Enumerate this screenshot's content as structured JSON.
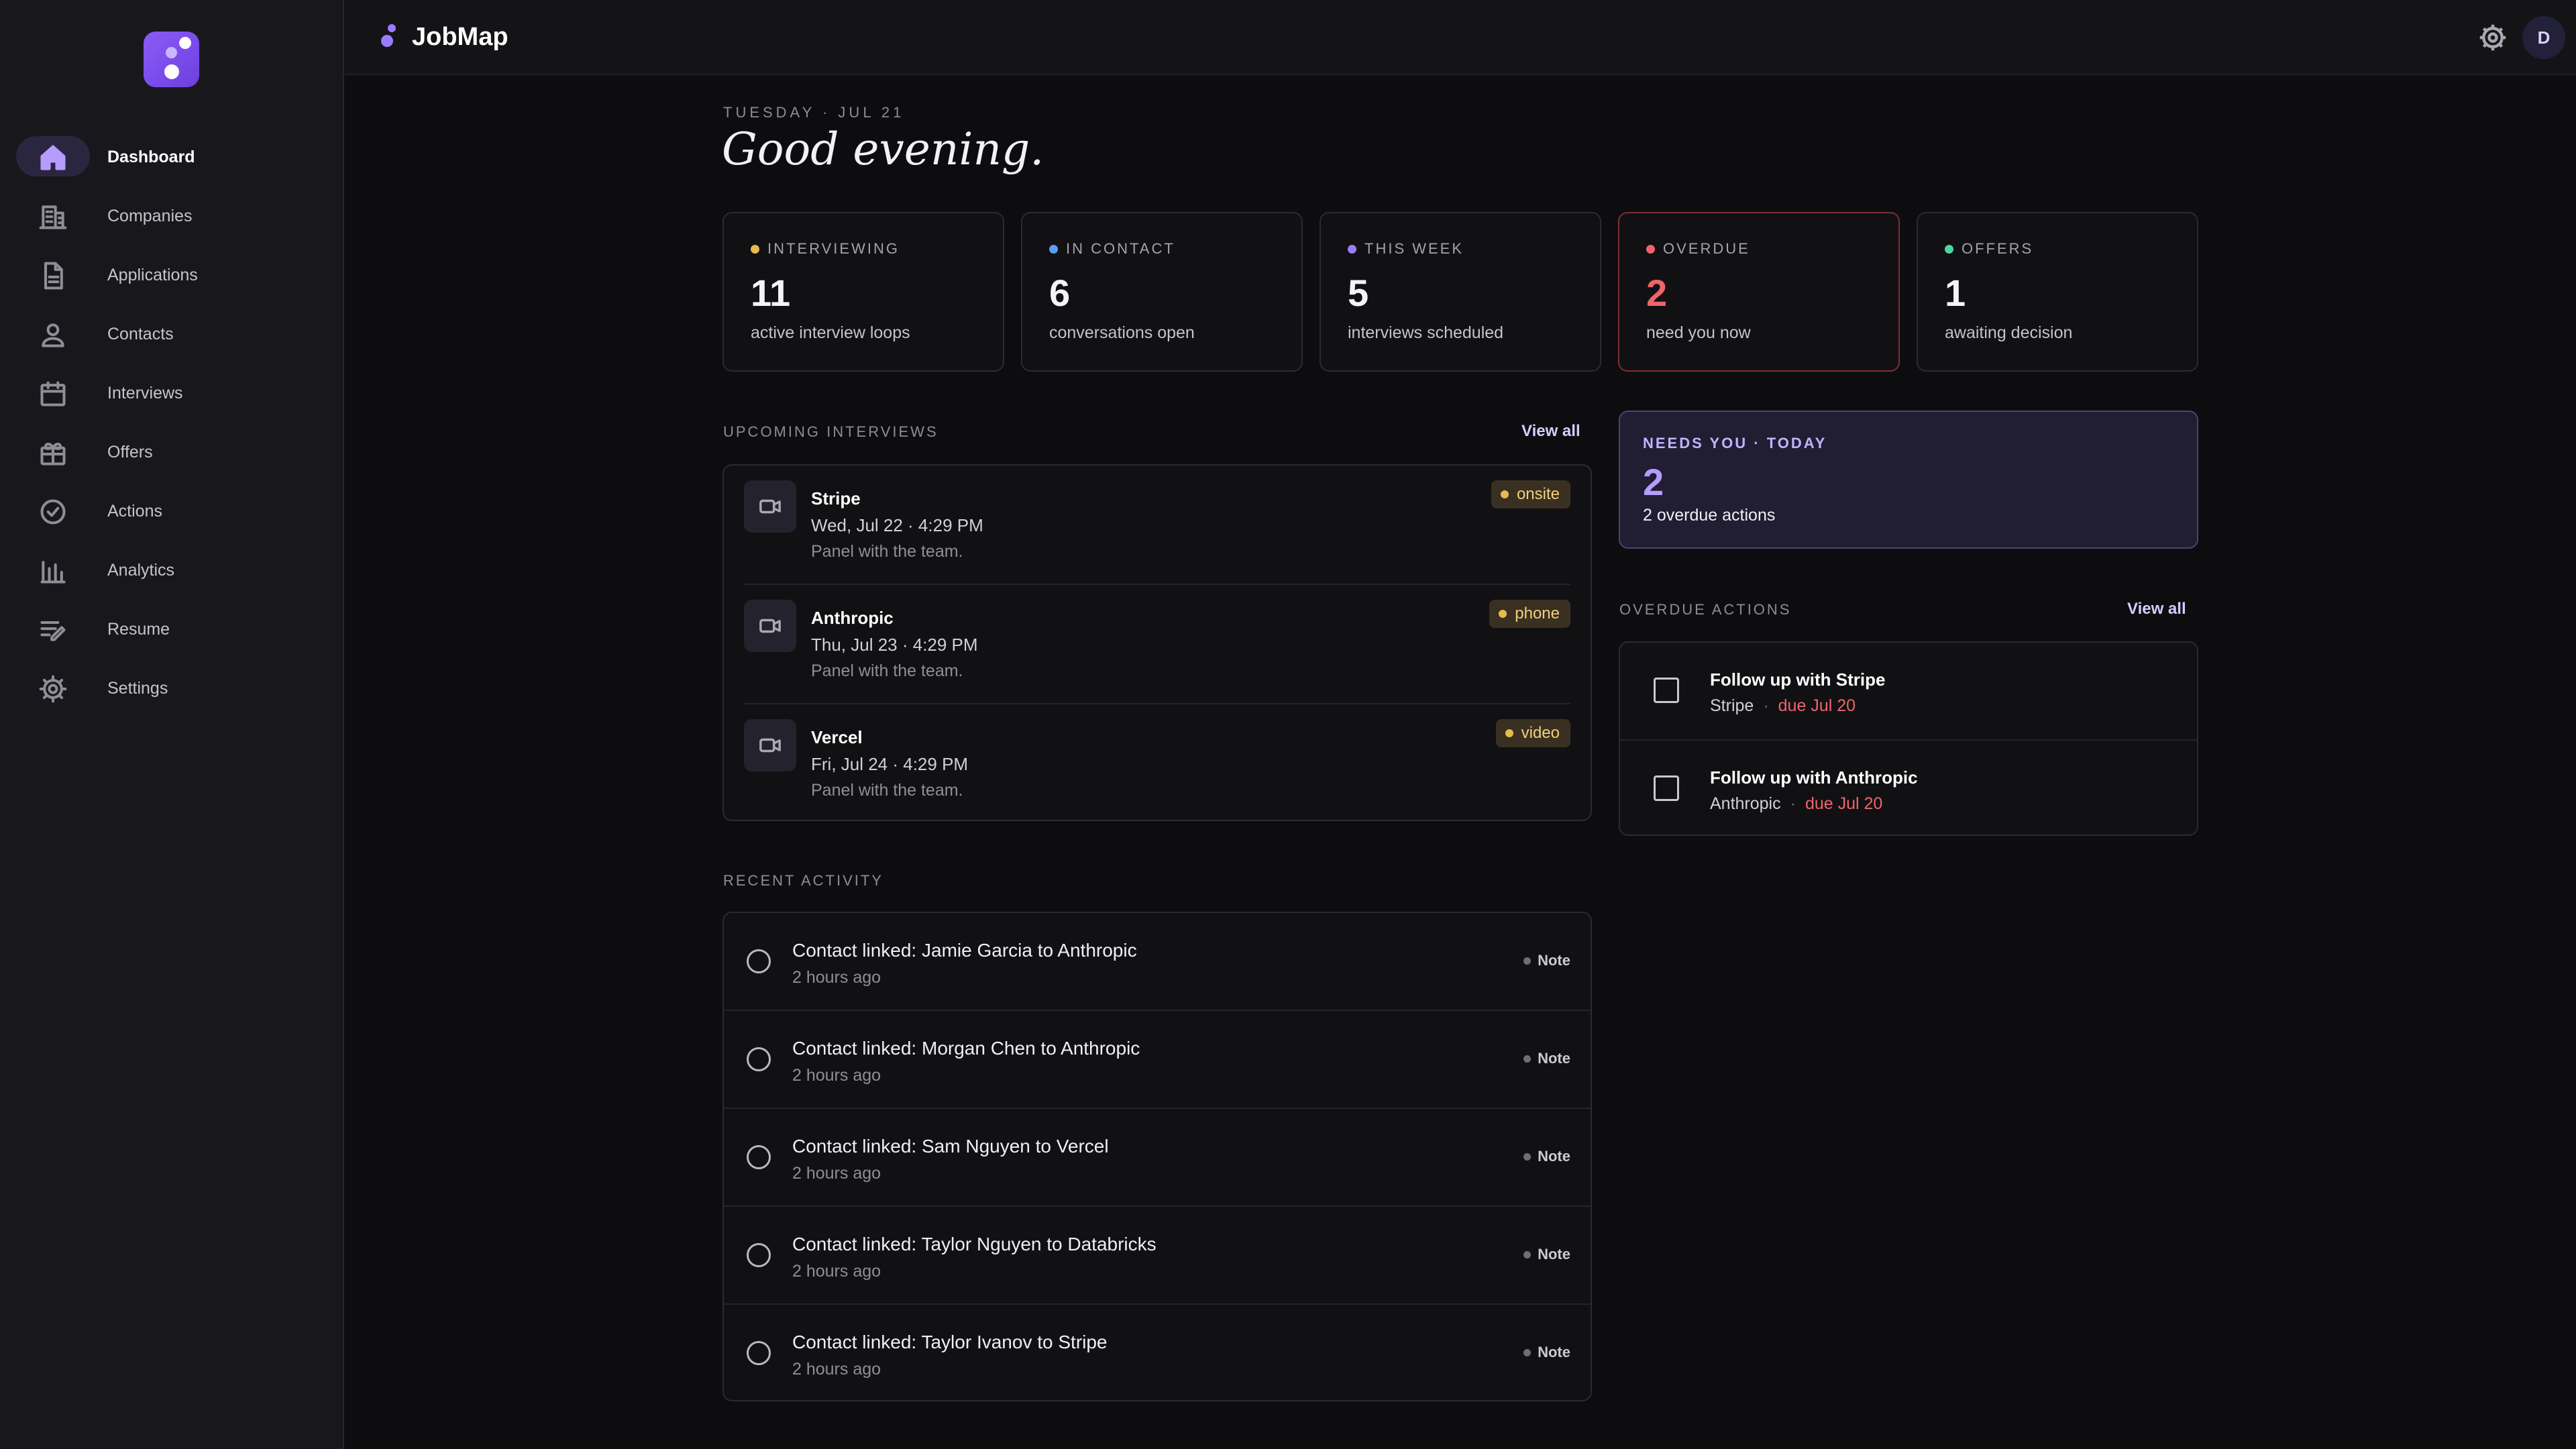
{
  "app": {
    "title": "JobMap",
    "avatar_initial": "D"
  },
  "sidebar": {
    "items": [
      {
        "label": "Dashboard",
        "icon": "home-icon",
        "active": true
      },
      {
        "label": "Companies",
        "icon": "building-icon"
      },
      {
        "label": "Applications",
        "icon": "document-icon"
      },
      {
        "label": "Contacts",
        "icon": "person-icon"
      },
      {
        "label": "Interviews",
        "icon": "calendar-icon"
      },
      {
        "label": "Offers",
        "icon": "gift-icon"
      },
      {
        "label": "Actions",
        "icon": "check-circle-icon"
      },
      {
        "label": "Analytics",
        "icon": "bar-chart-icon"
      },
      {
        "label": "Resume",
        "icon": "edit-list-icon"
      },
      {
        "label": "Settings",
        "icon": "gear-icon"
      }
    ]
  },
  "header": {
    "date": "TUESDAY · JUL 21",
    "greeting": "Good evening."
  },
  "stats": [
    {
      "label": "INTERVIEWING",
      "value": "11",
      "sub": "active interview loops",
      "dot_color": "#e8b94e"
    },
    {
      "label": "IN CONTACT",
      "value": "6",
      "sub": "conversations open",
      "dot_color": "#5b9cf5"
    },
    {
      "label": "THIS WEEK",
      "value": "5",
      "sub": "interviews scheduled",
      "dot_color": "#9b7bff"
    },
    {
      "label": "OVERDUE",
      "value": "2",
      "sub": "need you now",
      "dot_color": "#f0646a"
    },
    {
      "label": "OFFERS",
      "value": "1",
      "sub": "awaiting decision",
      "dot_color": "#4fd69c"
    }
  ],
  "upcoming": {
    "title": "UPCOMING INTERVIEWS",
    "view_all": "View all",
    "items": [
      {
        "company": "Stripe",
        "time": "Wed, Jul 22 · 4:29 PM",
        "note": "Panel with the team.",
        "type": "onsite"
      },
      {
        "company": "Anthropic",
        "time": "Thu, Jul 23 · 4:29 PM",
        "note": "Panel with the team.",
        "type": "phone"
      },
      {
        "company": "Vercel",
        "time": "Fri, Jul 24 · 4:29 PM",
        "note": "Panel with the team.",
        "type": "video"
      }
    ]
  },
  "activity": {
    "title": "RECENT ACTIVITY",
    "items": [
      {
        "title": "Contact linked: Jamie Garcia to Anthropic",
        "time": "2 hours ago",
        "tag": "Note"
      },
      {
        "title": "Contact linked: Morgan Chen to Anthropic",
        "time": "2 hours ago",
        "tag": "Note"
      },
      {
        "title": "Contact linked: Sam Nguyen to Vercel",
        "time": "2 hours ago",
        "tag": "Note"
      },
      {
        "title": "Contact linked: Taylor Nguyen to Databricks",
        "time": "2 hours ago",
        "tag": "Note"
      },
      {
        "title": "Contact linked: Taylor Ivanov to Stripe",
        "time": "2 hours ago",
        "tag": "Note"
      }
    ]
  },
  "needs_you": {
    "label": "NEEDS YOU · TODAY",
    "value": "2",
    "sub": "2 overdue actions"
  },
  "overdue": {
    "title": "OVERDUE ACTIONS",
    "view_all": "View all",
    "items": [
      {
        "title": "Follow up with Stripe",
        "company": "Stripe",
        "sep": "·",
        "due": "due Jul 20"
      },
      {
        "title": "Follow up with Anthropic",
        "company": "Anthropic",
        "sep": "·",
        "due": "due Jul 20"
      }
    ]
  }
}
